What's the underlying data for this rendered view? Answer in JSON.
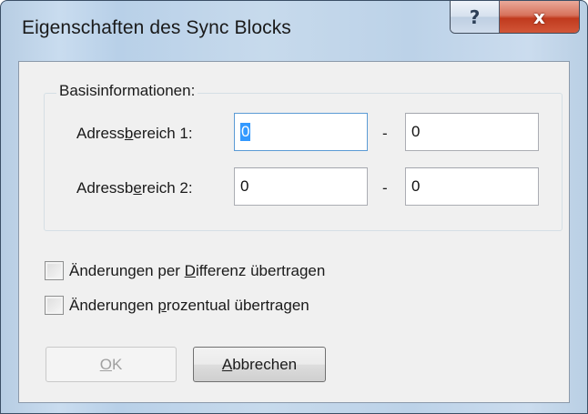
{
  "window": {
    "title": "Eigenschaften des Sync Blocks",
    "help_glyph": "?",
    "close_glyph": "x"
  },
  "group": {
    "label": "Basisinformationen:"
  },
  "range1": {
    "label_pre": "Adress",
    "label_ul": "b",
    "label_post": "ereich 1:",
    "from_value": "0",
    "separator": "-",
    "to_value": "0"
  },
  "range2": {
    "label_pre": "Adressb",
    "label_ul": "e",
    "label_post": "reich 2:",
    "from_value": "0",
    "separator": "-",
    "to_value": "0"
  },
  "options": {
    "diff_pre": "Änderungen per ",
    "diff_ul": "D",
    "diff_post": "ifferenz übertragen",
    "diff_checked": false,
    "pct_pre": "Änderungen ",
    "pct_ul": "p",
    "pct_post": "rozentual übertragen",
    "pct_checked": false
  },
  "buttons": {
    "ok_ul": "O",
    "ok_post": "K",
    "ok_enabled": false,
    "cancel_ul": "A",
    "cancel_post": "bbrechen"
  }
}
